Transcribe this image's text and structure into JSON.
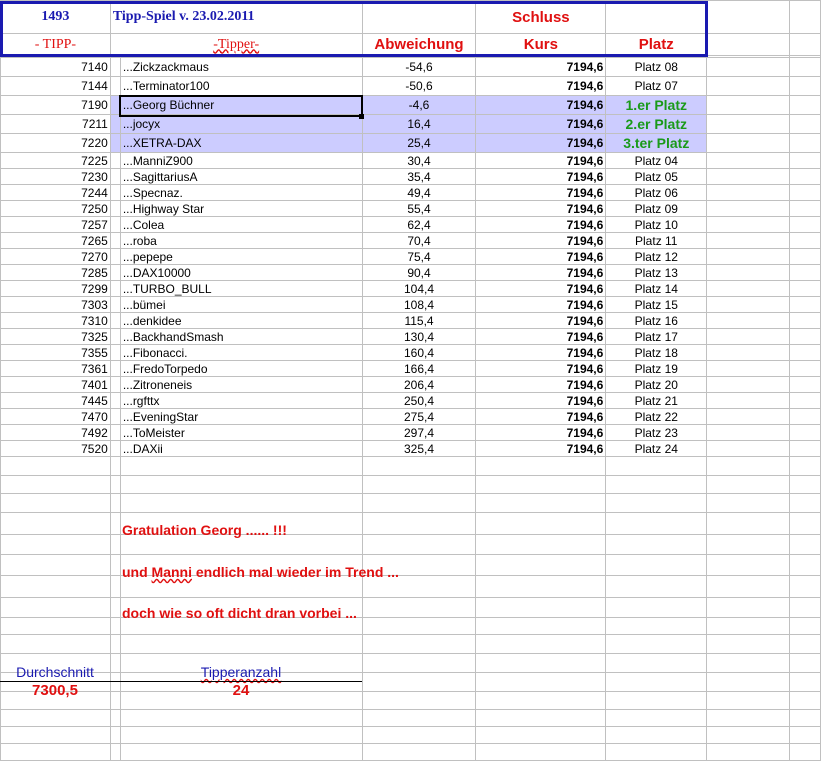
{
  "header": {
    "id": "1493",
    "title": "Tipp-Spiel v. 23.02.2011",
    "schluss": "Schluss",
    "col_tipp": "- TIPP-",
    "col_tipper": "-Tipper-",
    "col_abweichung": "Abweichung",
    "col_kurs": "Kurs",
    "col_platz": "Platz"
  },
  "rows": [
    {
      "tipp": "7140",
      "name": "...Zickzackmaus",
      "abw": "-54,6",
      "kurs": "7194,6",
      "platz": "Platz 08"
    },
    {
      "tipp": "7144",
      "name": "...Terminator100",
      "abw": "-50,6",
      "kurs": "7194,6",
      "platz": "Platz 07"
    },
    {
      "tipp": "7190",
      "name": "...Georg  Büchner",
      "abw": "-4,6",
      "kurs": "7194,6",
      "platz": "1.er Platz",
      "highlight": true
    },
    {
      "tipp": "7211",
      "name": "...jocyx",
      "abw": "16,4",
      "kurs": "7194,6",
      "platz": "2.er Platz",
      "highlight": true
    },
    {
      "tipp": "7220",
      "name": "...XETRA-DAX",
      "abw": "25,4",
      "kurs": "7194,6",
      "platz": "3.ter Platz",
      "highlight": true
    },
    {
      "tipp": "7225",
      "name": "...ManniZ900",
      "abw": "30,4",
      "kurs": "7194,6",
      "platz": "Platz 04"
    },
    {
      "tipp": "7230",
      "name": "...SagittariusA",
      "abw": "35,4",
      "kurs": "7194,6",
      "platz": "Platz 05"
    },
    {
      "tipp": "7244",
      "name": "...Specnaz.",
      "abw": "49,4",
      "kurs": "7194,6",
      "platz": "Platz 06"
    },
    {
      "tipp": "7250",
      "name": "...Highway Star",
      "abw": "55,4",
      "kurs": "7194,6",
      "platz": "Platz 09"
    },
    {
      "tipp": "7257",
      "name": "...Colea",
      "abw": "62,4",
      "kurs": "7194,6",
      "platz": "Platz 10"
    },
    {
      "tipp": "7265",
      "name": "...roba",
      "abw": "70,4",
      "kurs": "7194,6",
      "platz": "Platz 11"
    },
    {
      "tipp": "7270",
      "name": "...pepepe",
      "abw": "75,4",
      "kurs": "7194,6",
      "platz": "Platz 12"
    },
    {
      "tipp": "7285",
      "name": "...DAX10000",
      "abw": "90,4",
      "kurs": "7194,6",
      "platz": "Platz 13"
    },
    {
      "tipp": "7299",
      "name": "...TURBO_BULL",
      "abw": "104,4",
      "kurs": "7194,6",
      "platz": "Platz 14"
    },
    {
      "tipp": "7303",
      "name": "...bümei",
      "abw": "108,4",
      "kurs": "7194,6",
      "platz": "Platz 15"
    },
    {
      "tipp": "7310",
      "name": "...denkidee",
      "abw": "115,4",
      "kurs": "7194,6",
      "platz": "Platz 16"
    },
    {
      "tipp": "7325",
      "name": "...BackhandSmash",
      "abw": "130,4",
      "kurs": "7194,6",
      "platz": "Platz 17"
    },
    {
      "tipp": "7355",
      "name": "...Fibonacci.",
      "abw": "160,4",
      "kurs": "7194,6",
      "platz": "Platz 18"
    },
    {
      "tipp": "7361",
      "name": "...FredoTorpedo",
      "abw": "166,4",
      "kurs": "7194,6",
      "platz": "Platz 19"
    },
    {
      "tipp": "7401",
      "name": "...Zitroneneis",
      "abw": "206,4",
      "kurs": "7194,6",
      "platz": "Platz 20"
    },
    {
      "tipp": "7445",
      "name": "...rgfttx",
      "abw": "250,4",
      "kurs": "7194,6",
      "platz": "Platz 21"
    },
    {
      "tipp": "7470",
      "name": "...EveningStar",
      "abw": "275,4",
      "kurs": "7194,6",
      "platz": "Platz 22"
    },
    {
      "tipp": "7492",
      "name": "...ToMeister",
      "abw": "297,4",
      "kurs": "7194,6",
      "platz": "Platz 23"
    },
    {
      "tipp": "7520",
      "name": "...DAXii",
      "abw": "325,4",
      "kurs": "7194,6",
      "platz": "Platz 24"
    }
  ],
  "notes": {
    "line1": "Gratulation Georg ...... !!!",
    "line2_pre": "und ",
    "line2_wavy": "Manni",
    "line2_post": " endlich mal wieder im Trend ...",
    "line3": "doch wie so oft dicht dran vorbei ..."
  },
  "summary": {
    "avg_label": "Durchschnitt",
    "avg_value": "7300,5",
    "count_label": "Tipperanzahl",
    "count_value": "24"
  }
}
